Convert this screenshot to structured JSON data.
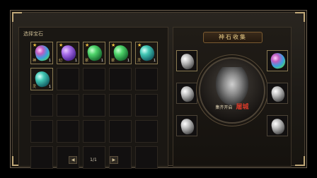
{
  "left_panel": {
    "title": "选择宝石",
    "gems": [
      {
        "color": "rainbow",
        "tag": "神",
        "count": "1",
        "star": "★"
      },
      {
        "color": "purple",
        "tag": "幻",
        "count": "1",
        "star": "★"
      },
      {
        "color": "green",
        "tag": "翠",
        "count": "1",
        "star": "★"
      },
      {
        "color": "green",
        "tag": "翠",
        "count": "1",
        "star": "★"
      },
      {
        "color": "teal",
        "tag": "灵",
        "count": "1",
        "star": "★"
      },
      {
        "color": "teal",
        "tag": "灵",
        "count": "1",
        "star": ""
      }
    ],
    "pager": {
      "prev": "◀",
      "next": "▶",
      "page": "1/1"
    }
  },
  "right_panel": {
    "banner": "神石收集",
    "caption": "集齐开启",
    "caption_target": "屠城",
    "side_slots": 8
  }
}
